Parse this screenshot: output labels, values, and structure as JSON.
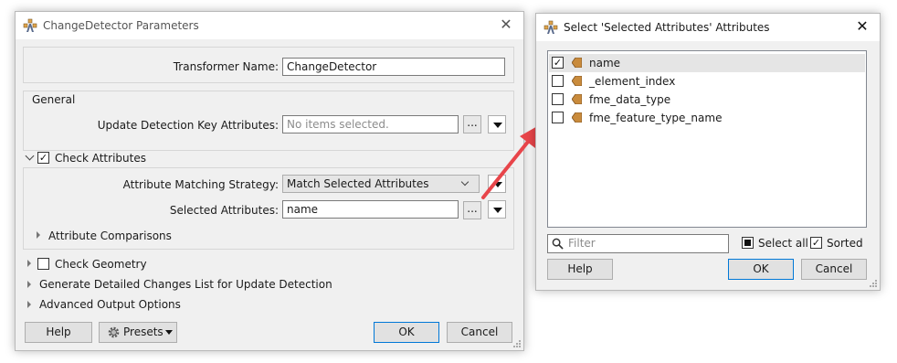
{
  "left_dialog": {
    "title": "ChangeDetector Parameters",
    "transformer_name_label": "Transformer Name:",
    "transformer_name_value": "ChangeDetector",
    "general_label": "General",
    "update_key_label": "Update Detection Key Attributes:",
    "update_key_placeholder": "No items selected.",
    "check_attributes_label": "Check Attributes",
    "matching_strategy_label": "Attribute Matching Strategy:",
    "matching_strategy_value": "Match Selected Attributes",
    "selected_attributes_label": "Selected Attributes:",
    "selected_attributes_value": "name",
    "attribute_comparisons_label": "Attribute Comparisons",
    "check_geometry_label": "Check Geometry",
    "detailed_changes_label": "Generate Detailed Changes List for Update Detection",
    "advanced_output_label": "Advanced Output Options",
    "help_button": "Help",
    "presets_button": "Presets",
    "ok_button": "OK",
    "cancel_button": "Cancel",
    "ellipsis": "..."
  },
  "right_dialog": {
    "title": "Select 'Selected Attributes' Attributes",
    "items": [
      {
        "label": "name",
        "checked": true
      },
      {
        "label": "_element_index",
        "checked": false
      },
      {
        "label": "fme_data_type",
        "checked": false
      },
      {
        "label": "fme_feature_type_name",
        "checked": false
      }
    ],
    "filter_placeholder": "Filter",
    "select_all_label": "Select all",
    "sorted_label": "Sorted",
    "help_button": "Help",
    "ok_button": "OK",
    "cancel_button": "Cancel"
  },
  "colors": {
    "dialog_bg": "#f0f0f0",
    "accent_blue": "#0078d7",
    "arrow_red": "#e8454a",
    "attr_icon": "#c98b3c"
  }
}
